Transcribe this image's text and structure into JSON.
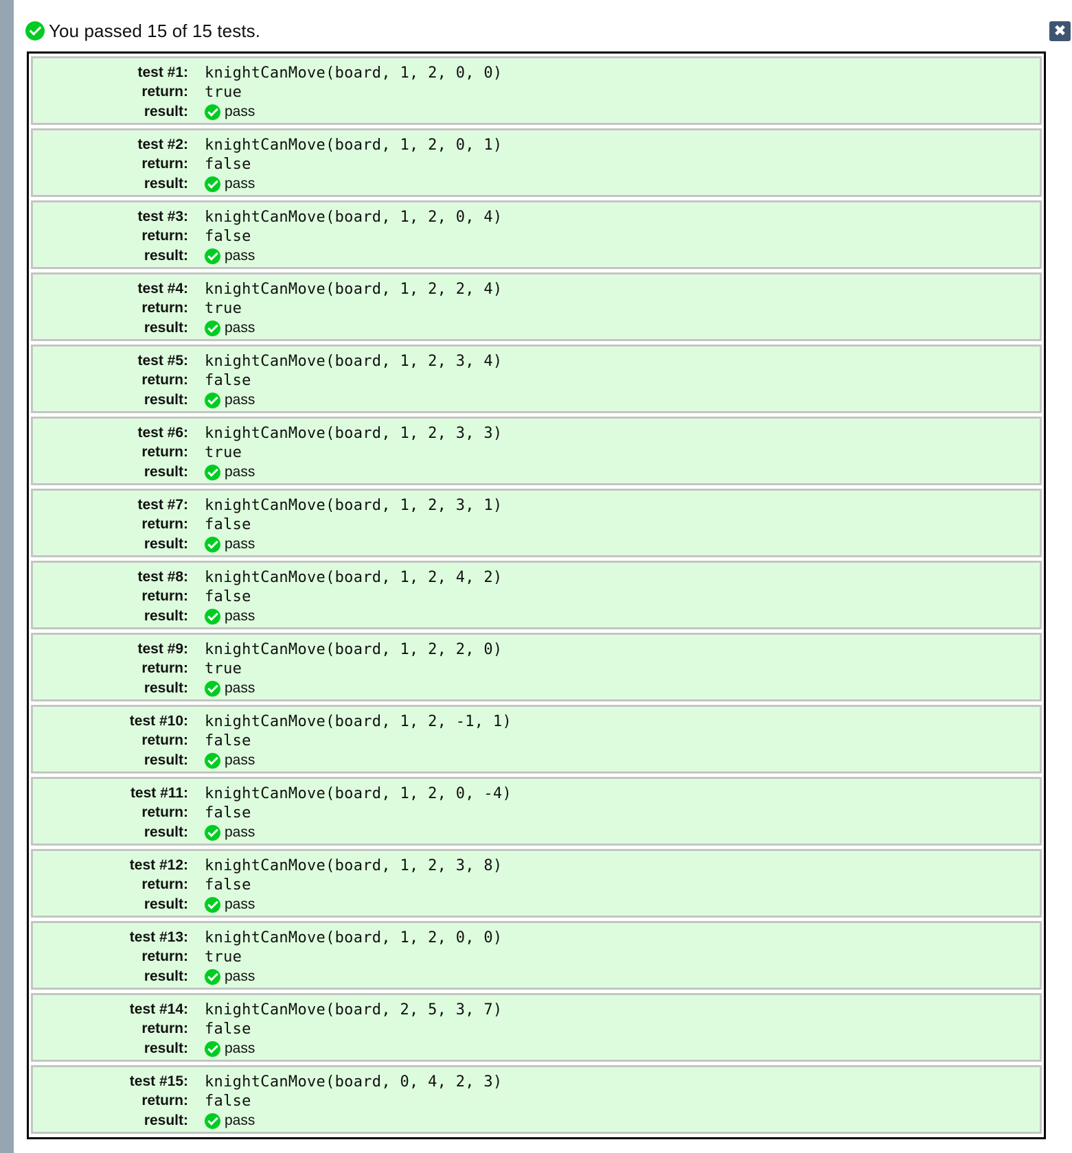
{
  "summary": {
    "text": "You passed 15 of 15 tests.",
    "icon": "check-circle-icon",
    "icon_color": "#00cc22"
  },
  "close_button": {
    "icon": "close-icon",
    "glyph": "✖",
    "color": "#3f5470"
  },
  "colors": {
    "pass_background": "#ddfcdd",
    "pass_icon": "#00cc22"
  },
  "labels": {
    "return": "return:",
    "result": "result:"
  },
  "tests": [
    {
      "label": "test #1:",
      "call": "knightCanMove(board, 1, 2, 0, 0)",
      "return": "true",
      "result": "pass"
    },
    {
      "label": "test #2:",
      "call": "knightCanMove(board, 1, 2, 0, 1)",
      "return": "false",
      "result": "pass"
    },
    {
      "label": "test #3:",
      "call": "knightCanMove(board, 1, 2, 0, 4)",
      "return": "false",
      "result": "pass"
    },
    {
      "label": "test #4:",
      "call": "knightCanMove(board, 1, 2, 2, 4)",
      "return": "true",
      "result": "pass"
    },
    {
      "label": "test #5:",
      "call": "knightCanMove(board, 1, 2, 3, 4)",
      "return": "false",
      "result": "pass"
    },
    {
      "label": "test #6:",
      "call": "knightCanMove(board, 1, 2, 3, 3)",
      "return": "true",
      "result": "pass"
    },
    {
      "label": "test #7:",
      "call": "knightCanMove(board, 1, 2, 3, 1)",
      "return": "false",
      "result": "pass"
    },
    {
      "label": "test #8:",
      "call": "knightCanMove(board, 1, 2, 4, 2)",
      "return": "false",
      "result": "pass"
    },
    {
      "label": "test #9:",
      "call": "knightCanMove(board, 1, 2, 2, 0)",
      "return": "true",
      "result": "pass"
    },
    {
      "label": "test #10:",
      "call": "knightCanMove(board, 1, 2, -1, 1)",
      "return": "false",
      "result": "pass"
    },
    {
      "label": "test #11:",
      "call": "knightCanMove(board, 1, 2, 0, -4)",
      "return": "false",
      "result": "pass"
    },
    {
      "label": "test #12:",
      "call": "knightCanMove(board, 1, 2, 3, 8)",
      "return": "false",
      "result": "pass"
    },
    {
      "label": "test #13:",
      "call": "knightCanMove(board, 1, 2, 0, 0)",
      "return": "true",
      "result": "pass"
    },
    {
      "label": "test #14:",
      "call": "knightCanMove(board, 2, 5, 3, 7)",
      "return": "false",
      "result": "pass"
    },
    {
      "label": "test #15:",
      "call": "knightCanMove(board, 0, 4, 2, 3)",
      "return": "false",
      "result": "pass"
    }
  ]
}
